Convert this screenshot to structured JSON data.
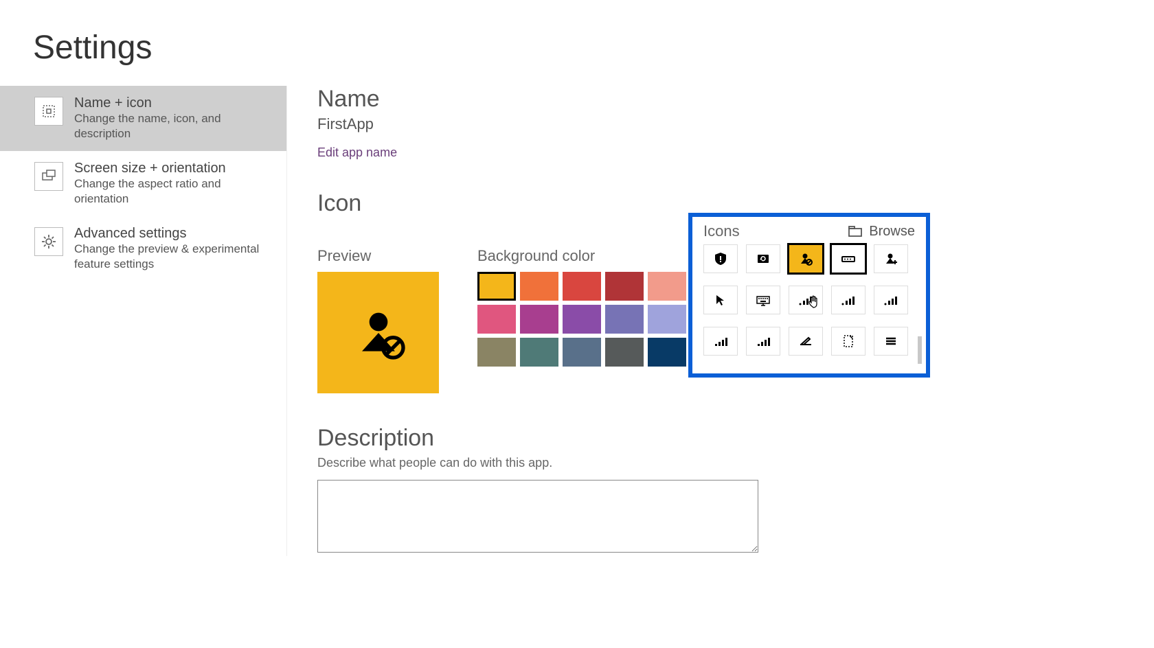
{
  "page_title": "Settings",
  "sidebar": [
    {
      "title": "Name + icon",
      "sub": "Change the name, icon, and description",
      "selected": true,
      "icon": "grid-icon"
    },
    {
      "title": "Screen size + orientation",
      "sub": "Change the aspect ratio and orientation",
      "selected": false,
      "icon": "screen-icon"
    },
    {
      "title": "Advanced settings",
      "sub": "Change the preview & experimental feature settings",
      "selected": false,
      "icon": "gear-icon"
    }
  ],
  "name_section": {
    "heading": "Name",
    "value": "FirstApp",
    "edit_link": "Edit app name"
  },
  "icon_section": {
    "heading": "Icon",
    "preview_label": "Preview",
    "bg_label": "Background color",
    "preview_bg": "#f4b61a",
    "preview_icon": "user-blocked-icon",
    "colors": [
      {
        "hex": "#f4b61a",
        "selected": true
      },
      {
        "hex": "#f0713a",
        "selected": false
      },
      {
        "hex": "#d9463f",
        "selected": false
      },
      {
        "hex": "#b03437",
        "selected": false
      },
      {
        "hex": "#f29b8b",
        "selected": false
      },
      {
        "hex": "#e0567f",
        "selected": false
      },
      {
        "hex": "#a83e8f",
        "selected": false
      },
      {
        "hex": "#8a4ca8",
        "selected": false
      },
      {
        "hex": "#7773b5",
        "selected": false
      },
      {
        "hex": "#9fa3dc",
        "selected": false
      },
      {
        "hex": "#8a8464",
        "selected": false
      },
      {
        "hex": "#4f7a77",
        "selected": false
      },
      {
        "hex": "#59708a",
        "selected": false
      },
      {
        "hex": "#565a5a",
        "selected": false
      },
      {
        "hex": "#083a66",
        "selected": false
      }
    ],
    "icons_label": "Icons",
    "browse_label": "Browse",
    "icon_choices": [
      {
        "name": "shield-alert-icon",
        "selected": false
      },
      {
        "name": "sync-photo-icon",
        "selected": false
      },
      {
        "name": "user-blocked-icon",
        "selected": true
      },
      {
        "name": "input-field-icon",
        "selected": false,
        "secondary": true
      },
      {
        "name": "user-add-icon",
        "selected": false
      },
      {
        "name": "pointer-icon",
        "selected": false
      },
      {
        "name": "keyboard-icon",
        "selected": false
      },
      {
        "name": "signal-1-icon",
        "selected": false
      },
      {
        "name": "signal-2-icon",
        "selected": false
      },
      {
        "name": "signal-3-icon",
        "selected": false
      },
      {
        "name": "signal-4-icon",
        "selected": false
      },
      {
        "name": "signal-full-icon",
        "selected": false
      },
      {
        "name": "scanner-icon",
        "selected": false
      },
      {
        "name": "dotted-page-icon",
        "selected": false
      },
      {
        "name": "menu-icon",
        "selected": false
      }
    ]
  },
  "description_section": {
    "heading": "Description",
    "sub": "Describe what people can do with this app.",
    "value": ""
  }
}
